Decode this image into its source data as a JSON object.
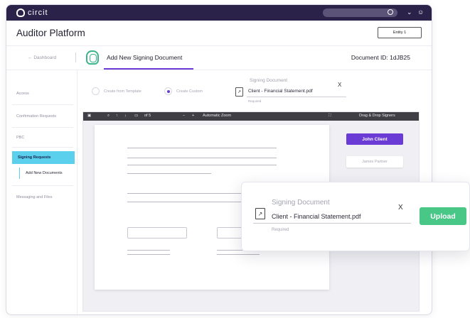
{
  "topbar": {
    "brand": "circit"
  },
  "header": {
    "app_title": "Auditor Platform",
    "entity_button": "Entity 1"
  },
  "crumb": {
    "back_label": "Dashboard",
    "title": "Add New Signing Document",
    "document_id": "Document ID: 1dJB25"
  },
  "sidebar": {
    "items": [
      "Access",
      "Confirmation Requests",
      "PBC",
      "Signing Requests",
      "Add New Documents",
      "Messaging and Files"
    ]
  },
  "form": {
    "option_template": "Create from Template",
    "option_custom": "Create Custom",
    "signing_label": "Signing Document",
    "file_name": "Client - Financial Statement.pdf",
    "required_note": "Required",
    "remove": "X"
  },
  "viewer": {
    "page_info": "of 5",
    "zoom_label": "Automatic Zoom",
    "panel_title": "Drag & Drop Signers",
    "signers": [
      "John Client",
      "James Partner"
    ]
  },
  "popup": {
    "signing_label": "Signing Document",
    "file_name": "Client - Financial Statement.pdf",
    "required_note": "Required",
    "remove": "X",
    "upload_label": "Upload"
  }
}
